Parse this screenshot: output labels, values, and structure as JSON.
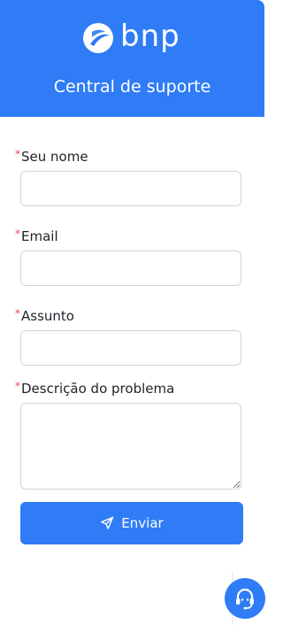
{
  "header": {
    "brand": "bnp",
    "title": "Central de suporte",
    "background_color": "#2f7cf6"
  },
  "form": {
    "required_marker": "*",
    "fields": [
      {
        "label": "Seu nome",
        "value": "",
        "type": "text"
      },
      {
        "label": "Email",
        "value": "",
        "type": "text"
      },
      {
        "label": "Assunto",
        "value": "",
        "type": "text"
      },
      {
        "label": "Descrição do problema",
        "value": "",
        "type": "textarea"
      }
    ],
    "submit_label": "Enviar",
    "submit_icon": "send-icon"
  },
  "support_button": {
    "icon": "headset-icon",
    "color": "#2f7cf6"
  }
}
